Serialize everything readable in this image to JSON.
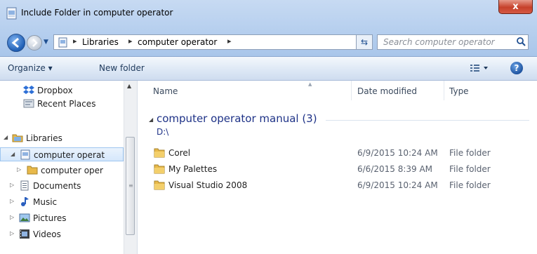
{
  "window": {
    "title": "Include Folder in computer operator",
    "close_label": "x"
  },
  "address": {
    "crumbs": [
      "Libraries",
      "computer operator"
    ],
    "search_placeholder": "Search computer operator"
  },
  "toolbar": {
    "organize_label": "Organize ▾",
    "new_folder_label": "New folder",
    "help_label": "?"
  },
  "nav": {
    "items": [
      {
        "label": "Dropbox",
        "icon": "dropbox-icon"
      },
      {
        "label": "Recent Places",
        "icon": "recent-places-icon"
      },
      {
        "label": "Libraries",
        "icon": "libraries-icon"
      },
      {
        "label": "computer operat",
        "icon": "library-icon"
      },
      {
        "label": "computer oper",
        "icon": "folder-icon"
      },
      {
        "label": "Documents",
        "icon": "documents-icon"
      },
      {
        "label": "Music",
        "icon": "music-icon"
      },
      {
        "label": "Pictures",
        "icon": "pictures-icon"
      },
      {
        "label": "Videos",
        "icon": "videos-icon"
      }
    ]
  },
  "columns": {
    "name": "Name",
    "date": "Date modified",
    "type": "Type"
  },
  "group": {
    "title": "computer operator manual (3)",
    "path": "D:\\"
  },
  "files": [
    {
      "name": "Corel",
      "date": "6/9/2015 10:24 AM",
      "type": "File folder"
    },
    {
      "name": "My Palettes",
      "date": "6/6/2015 8:39 AM",
      "type": "File folder"
    },
    {
      "name": "Visual Studio 2008",
      "date": "6/9/2015 10:24 AM",
      "type": "File folder"
    }
  ],
  "colors": {
    "accent": "#1e3287",
    "titlebar": "#b9d1ef",
    "close": "#c6412b",
    "folder": "#e8b94a"
  }
}
